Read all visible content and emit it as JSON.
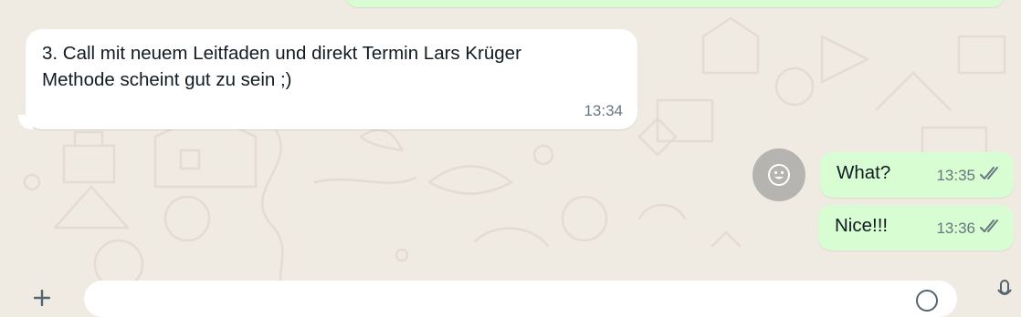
{
  "messages": [
    {
      "direction": "incoming",
      "text": "3. Call mit neuem Leitfaden und direkt Termin Lars Krüger\nMethode scheint gut zu sein ;)",
      "time": "13:34"
    },
    {
      "direction": "outgoing",
      "text": "What?",
      "time": "13:35",
      "status": "read"
    },
    {
      "direction": "outgoing",
      "text": "Nice!!!",
      "time": "13:36",
      "status": "read"
    }
  ],
  "icons": {
    "reaction": "emoji-reaction-icon",
    "read_receipt": "double-check-icon",
    "attach": "plus-icon",
    "composer_emoji": "emoji-icon",
    "mic": "microphone-icon"
  },
  "colors": {
    "background": "#efeae2",
    "incoming_bubble": "#ffffff",
    "outgoing_bubble": "#d9fdd3",
    "timestamp": "#667781",
    "text": "#111b21"
  }
}
